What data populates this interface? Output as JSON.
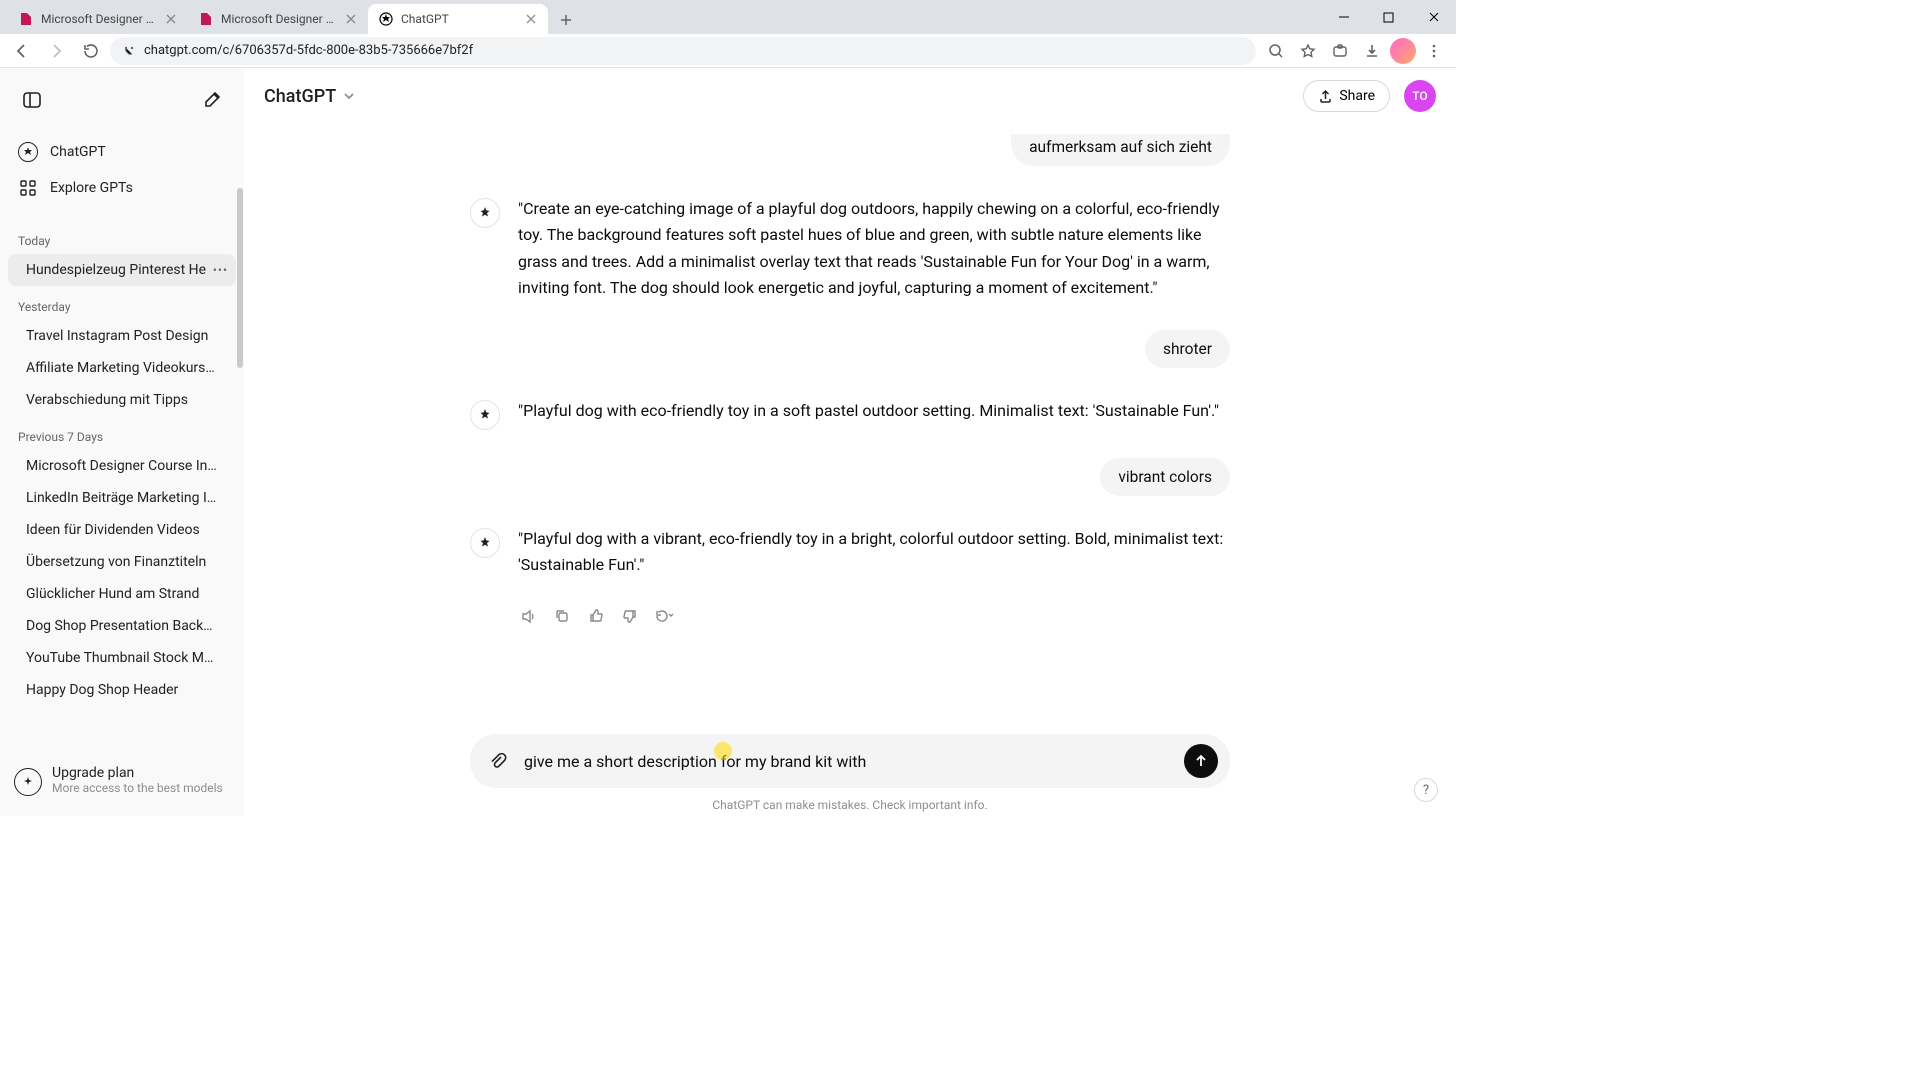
{
  "browser": {
    "tabs": [
      {
        "title": "Microsoft Designer - Stunning",
        "favicon_color": "#c2185b",
        "active": false
      },
      {
        "title": "Microsoft Designer - Stunning",
        "favicon_color": "#c2185b",
        "active": false
      },
      {
        "title": "ChatGPT",
        "favicon_color": "#000",
        "active": true
      }
    ],
    "url": "chatgpt.com/c/6706357d-5fdc-800e-83b5-735666e7bf2f"
  },
  "app": {
    "model_label": "ChatGPT",
    "share_label": "Share",
    "user_initials": "TO"
  },
  "sidebar": {
    "nav": [
      {
        "label": "ChatGPT"
      },
      {
        "label": "Explore GPTs"
      }
    ],
    "sections": [
      {
        "title": "Today",
        "items": [
          {
            "label": "Hundespielzeug Pinterest He",
            "active": true
          }
        ]
      },
      {
        "title": "Yesterday",
        "items": [
          {
            "label": "Travel Instagram Post Design"
          },
          {
            "label": "Affiliate Marketing Videokurs O"
          },
          {
            "label": "Verabschiedung mit Tipps"
          }
        ]
      },
      {
        "title": "Previous 7 Days",
        "items": [
          {
            "label": "Microsoft Designer Course Intro"
          },
          {
            "label": "LinkedIn Beiträge Marketing Ide"
          },
          {
            "label": "Ideen für Dividenden Videos"
          },
          {
            "label": "Übersetzung von Finanztiteln"
          },
          {
            "label": "Glücklicher Hund am Strand"
          },
          {
            "label": "Dog Shop Presentation Backgro"
          },
          {
            "label": "YouTube Thumbnail Stock Marke"
          },
          {
            "label": "Happy Dog Shop Header"
          }
        ]
      }
    ],
    "upgrade": {
      "title": "Upgrade plan",
      "subtitle": "More access to the best models"
    }
  },
  "chat": {
    "truncated_user_text": "aufmerksam auf sich zieht",
    "messages": [
      {
        "role": "assistant",
        "text": "\"Create an eye-catching image of a playful dog outdoors, happily chewing on a colorful, eco-friendly toy. The background features soft pastel hues of blue and green, with subtle nature elements like grass and trees. Add a minimalist overlay text that reads 'Sustainable Fun for Your Dog' in a warm, inviting font. The dog should look energetic and joyful, capturing a moment of excitement.\""
      },
      {
        "role": "user",
        "text": "shroter"
      },
      {
        "role": "assistant",
        "text": "\"Playful dog with eco-friendly toy in a soft pastel outdoor setting. Minimalist text: 'Sustainable Fun'.\""
      },
      {
        "role": "user",
        "text": "vibrant colors"
      },
      {
        "role": "assistant",
        "text": "\"Playful dog with a vibrant, eco-friendly toy in a bright, colorful outdoor setting. Bold, minimalist text: 'Sustainable Fun'.\""
      }
    ],
    "composer_value": "give me a short description for my brand kit with",
    "disclaimer": "ChatGPT can make mistakes. Check important info."
  }
}
